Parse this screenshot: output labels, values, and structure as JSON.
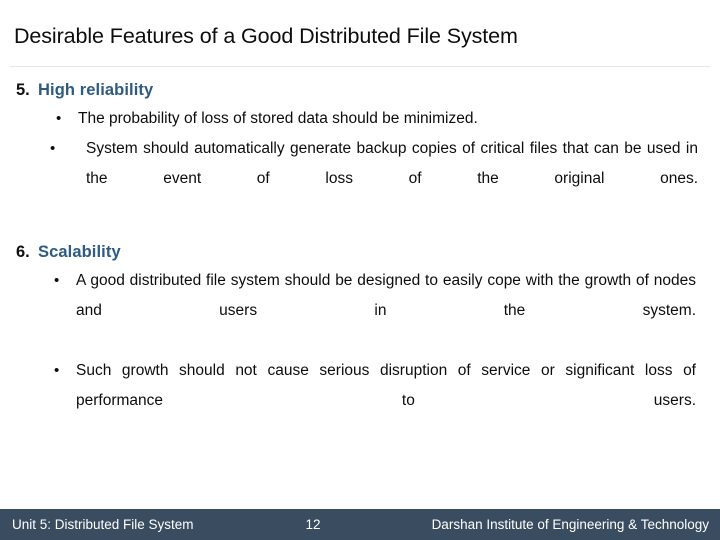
{
  "slide": {
    "title": "Desirable Features of a Good Distributed File System",
    "accent_color": "#2d5b82",
    "footer_bar_color": "#3a4c60",
    "text_color": "#0d0d0d",
    "rule_color": "#e2e4e6"
  },
  "sections": [
    {
      "number": "5.",
      "heading": "High reliability",
      "bullets": [
        {
          "marker": "•",
          "text": "The probability of loss of stored data should be minimized."
        },
        {
          "marker": "•",
          "text": "System should automatically generate backup copies of critical files that can be used in the event of loss of the original ones."
        }
      ]
    },
    {
      "number": "6.",
      "heading": "Scalability",
      "bullets": [
        {
          "marker": "•",
          "text": "A good distributed file system should be designed to easily cope with the growth of nodes and users in the system."
        },
        {
          "marker": "•",
          "text": "Such growth should not cause serious disruption of service or significant loss of performance to users."
        }
      ]
    }
  ],
  "footer": {
    "left": "Unit 5: Distributed File System",
    "page_number": "12",
    "right": "Darshan Institute of Engineering & Technology"
  }
}
